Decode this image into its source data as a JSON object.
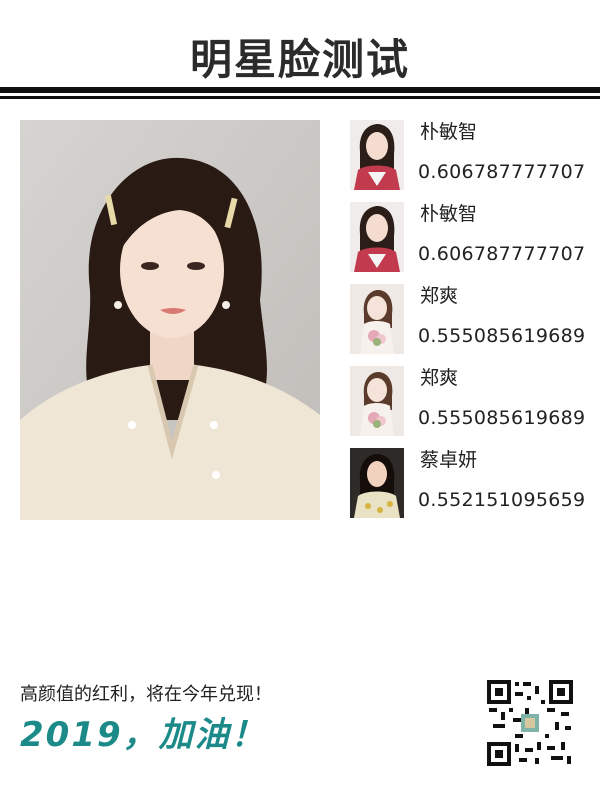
{
  "header": {
    "title": "明星脸测试"
  },
  "results": [
    {
      "name": "朴敏智",
      "score": "0.606787777707",
      "thumb": "girl-pink-dress"
    },
    {
      "name": "朴敏智",
      "score": "0.606787777707",
      "thumb": "girl-pink-dress"
    },
    {
      "name": "郑爽",
      "score": "0.555085619689",
      "thumb": "bride-bouquet"
    },
    {
      "name": "郑爽",
      "score": "0.555085619689",
      "thumb": "bride-bouquet"
    },
    {
      "name": "蔡卓妍",
      "score": "0.552151095659",
      "thumb": "woman-floral-dress"
    }
  ],
  "footer": {
    "tagline": "高颜值的红利，将在今年兑现！",
    "slogan": "2019，加油！"
  },
  "colors": {
    "accent": "#1d8a8a",
    "rule": "#111111"
  }
}
